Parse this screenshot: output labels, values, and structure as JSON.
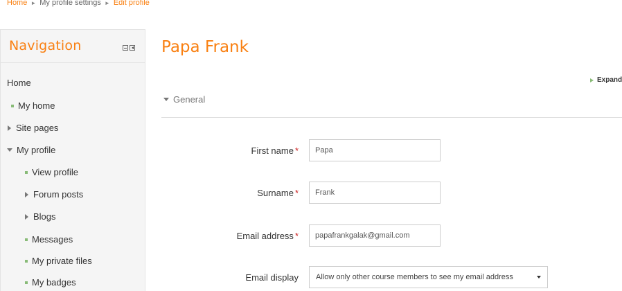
{
  "breadcrumb": {
    "items": [
      "Home",
      "My profile settings",
      "Edit profile"
    ]
  },
  "navigation": {
    "title": "Navigation",
    "items": [
      {
        "label": "Home",
        "icon": "none"
      },
      {
        "label": "My home",
        "icon": "bullet"
      },
      {
        "label": "Site pages",
        "icon": "expand"
      },
      {
        "label": "My profile",
        "icon": "collapse"
      },
      {
        "label": "View profile",
        "icon": "bullet"
      },
      {
        "label": "Forum posts",
        "icon": "expand"
      },
      {
        "label": "Blogs",
        "icon": "expand"
      },
      {
        "label": "Messages",
        "icon": "bullet"
      },
      {
        "label": "My private files",
        "icon": "bullet"
      },
      {
        "label": "My badges",
        "icon": "bullet"
      }
    ]
  },
  "main": {
    "title": "Papa Frank",
    "expand_all": "Expand",
    "section": "General"
  },
  "form": {
    "first_name_label": "First name",
    "first_name_value": "Papa",
    "surname_label": "Surname",
    "surname_value": "Frank",
    "email_label": "Email address",
    "email_value": "papafrankgalak@gmail.com",
    "email_display_label": "Email display",
    "email_display_value": "Allow only other course members to see my email address",
    "required_marker": "*"
  },
  "colors": {
    "accent": "#f98012",
    "required": "#cc2222",
    "bullet": "#88bb77"
  }
}
